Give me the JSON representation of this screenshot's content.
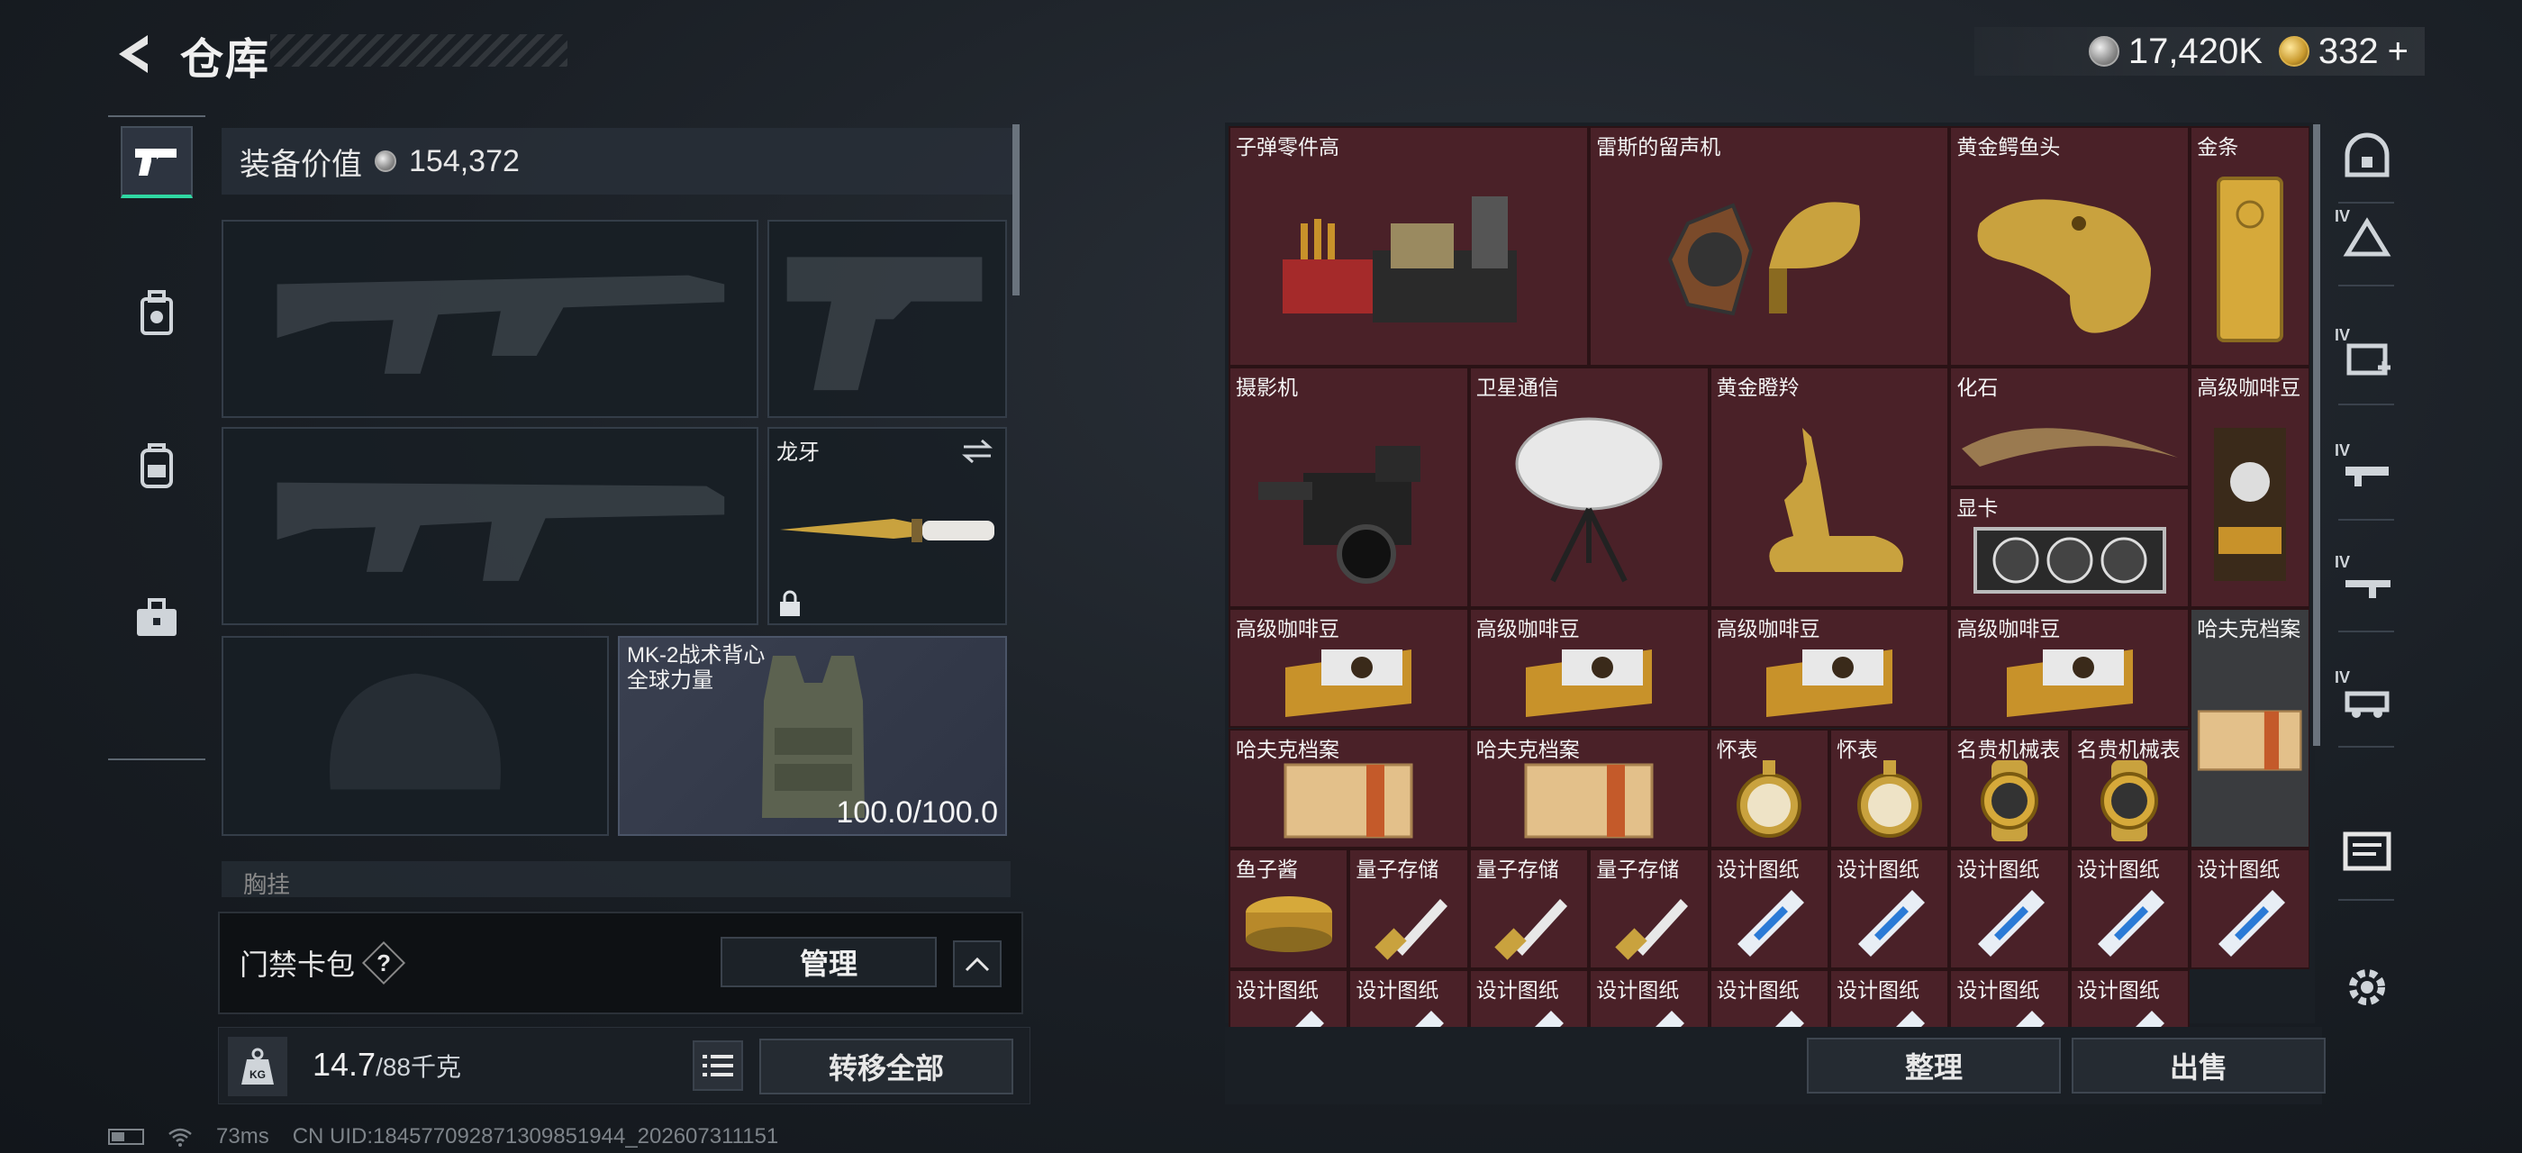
{
  "header": {
    "title": "仓库",
    "currency_silver": "17,420K",
    "currency_gold": "332",
    "currency_gold_add": "+"
  },
  "sidebar": {
    "tabs": [
      {
        "name": "weapon",
        "icon": "pistol-icon",
        "active": true
      },
      {
        "name": "keycard",
        "icon": "keycard-bag-icon",
        "active": false
      },
      {
        "name": "backpack",
        "icon": "backpack-icon",
        "active": false
      },
      {
        "name": "case",
        "icon": "briefcase-icon",
        "active": false
      }
    ]
  },
  "equipment": {
    "value_label": "装备价值",
    "value": "154,372",
    "melee_name": "龙牙",
    "vest_name_line1": "MK-2战术背心",
    "vest_name_line2": "全球力量",
    "vest_durability": "100.0/100.0",
    "chest_label": "胸挂"
  },
  "keycard": {
    "label": "门禁卡包",
    "help": "?",
    "manage_label": "管理"
  },
  "weight": {
    "kg_label": "KG",
    "current": "14.7",
    "max": "/88千克",
    "transfer_all_label": "转移全部"
  },
  "storage": {
    "items": [
      {
        "name": "子弹零件高",
        "art": "crate"
      },
      {
        "name": "雷斯的留声机",
        "art": "gramophone"
      },
      {
        "name": "黄金鳄鱼头",
        "art": "croc"
      },
      {
        "name": "金条",
        "art": "goldbar"
      },
      {
        "name": "摄影机",
        "art": "camera"
      },
      {
        "name": "卫星通信",
        "art": "dish"
      },
      {
        "name": "黄金瞪羚",
        "art": "gazelle"
      },
      {
        "name": "化石",
        "art": "fossil"
      },
      {
        "name": "高级咖啡豆",
        "art": "coffeebag"
      },
      {
        "name": "显卡",
        "art": "gpu"
      },
      {
        "name": "高级咖啡豆",
        "art": "coffee"
      },
      {
        "name": "高级咖啡豆",
        "art": "coffee"
      },
      {
        "name": "高级咖啡豆",
        "art": "coffee"
      },
      {
        "name": "高级咖啡豆",
        "art": "coffee"
      },
      {
        "name": "哈夫克档案",
        "art": "file"
      },
      {
        "name": "哈夫克档案",
        "art": "file"
      },
      {
        "name": "哈夫克档案",
        "art": "file"
      },
      {
        "name": "怀表",
        "art": "watch"
      },
      {
        "name": "怀表",
        "art": "watch"
      },
      {
        "name": "名贵机械表",
        "art": "wrist"
      },
      {
        "name": "名贵机械表",
        "art": "wrist"
      },
      {
        "name": "鱼子酱",
        "art": "caviar"
      },
      {
        "name": "量子存储",
        "art": "usb"
      },
      {
        "name": "量子存储",
        "art": "usb"
      },
      {
        "name": "量子存储",
        "art": "usb"
      },
      {
        "name": "设计图纸",
        "art": "blueprint"
      },
      {
        "name": "设计图纸",
        "art": "blueprint"
      },
      {
        "name": "设计图纸",
        "art": "blueprint"
      },
      {
        "name": "设计图纸",
        "art": "blueprint"
      },
      {
        "name": "设计图纸",
        "art": "blueprint"
      },
      {
        "name": "设计图纸",
        "art": "blueprint"
      },
      {
        "name": "设计图纸",
        "art": "blueprint"
      },
      {
        "name": "设计图纸",
        "art": "blueprint"
      },
      {
        "name": "设计图纸",
        "art": "blueprint"
      },
      {
        "name": "设计图纸",
        "art": "blueprint"
      },
      {
        "name": "设计图纸",
        "art": "blueprint"
      },
      {
        "name": "设计图纸",
        "art": "blueprint"
      },
      {
        "name": "设计图纸",
        "art": "blueprint"
      }
    ],
    "sort_label": "整理",
    "sell_label": "出售"
  },
  "right_rail": {
    "icons": [
      "home-case-icon",
      "supply-tier4-icon",
      "medical-tier4-icon",
      "weapon-tier4-icon",
      "weapon-tier4-alt-icon",
      "vehicle-tier4-icon",
      "blueprint-icon",
      "settings-icon"
    ],
    "badge": "IV"
  },
  "status": {
    "ping": "73ms",
    "uid": "CN UID:1845770928713098519​44_202607311151"
  }
}
